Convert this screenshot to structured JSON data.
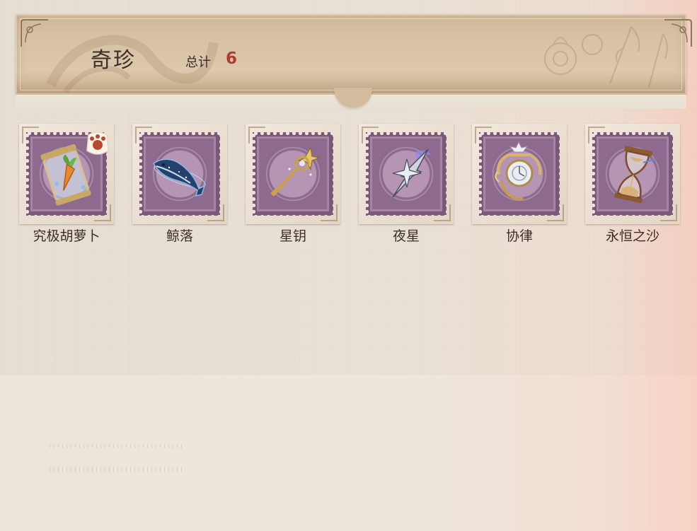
{
  "header": {
    "title": "奇珍",
    "total_label": "总计",
    "total_value": "6"
  },
  "items": [
    {
      "label": "究极胡萝卜",
      "icon": "carrot-jar-icon",
      "badge": "paw-sticker-icon"
    },
    {
      "label": "鲸落",
      "icon": "whale-icon"
    },
    {
      "label": "星钥",
      "icon": "star-key-icon"
    },
    {
      "label": "夜星",
      "icon": "night-star-icon"
    },
    {
      "label": "协律",
      "icon": "pocket-watch-icon"
    },
    {
      "label": "永恒之沙",
      "icon": "hourglass-icon"
    }
  ],
  "colors": {
    "banner": "#d8c2a6",
    "stamp": "#8e6a8e",
    "accent_number": "#b03a33",
    "text": "#3b2e25"
  }
}
